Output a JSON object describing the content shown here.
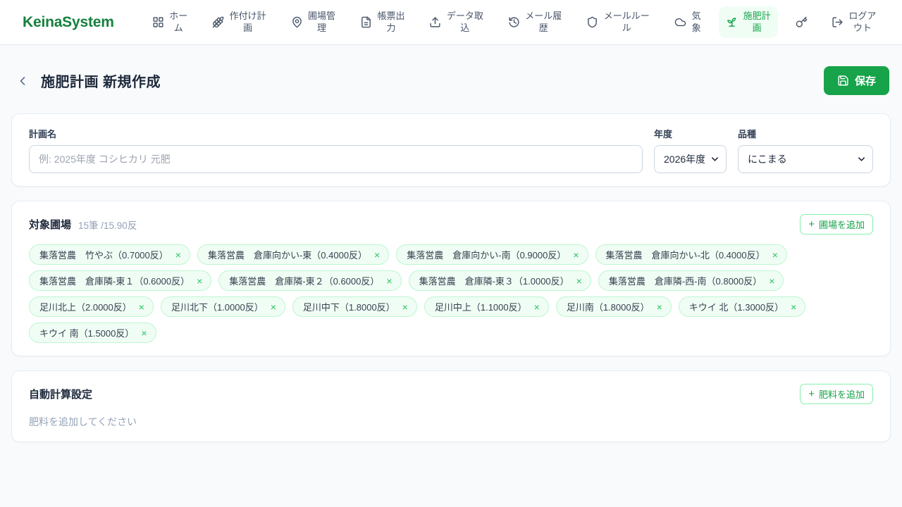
{
  "app": {
    "title": "KeinaSystem"
  },
  "colors": {
    "brand_green": "#15803d",
    "accent_green": "#16a34a",
    "active_nav_bg": "#f0fdf4",
    "chip_bg": "#f0fdf4",
    "chip_border": "#bbf7d0",
    "outline_button_border": "#86efac",
    "page_bg": "#f8fafc"
  },
  "icons": {
    "back": "chevron-left",
    "save": "floppy-disk",
    "select": "chevron-down",
    "nav": [
      "grid",
      "wheat",
      "map-pin",
      "document",
      "upload",
      "history",
      "shield",
      "cloud",
      "sprout",
      "key",
      "logout"
    ]
  },
  "nav": {
    "items": [
      {
        "label": "ホーム",
        "icon": "grid-icon",
        "active": false
      },
      {
        "label": "作付け計画",
        "icon": "wheat-icon",
        "active": false
      },
      {
        "label": "圃場管理",
        "icon": "map-pin-icon",
        "active": false
      },
      {
        "label": "帳票出力",
        "icon": "document-icon",
        "active": false
      },
      {
        "label": "データ取込",
        "icon": "upload-icon",
        "active": false
      },
      {
        "label": "メール履歴",
        "icon": "history-icon",
        "active": false
      },
      {
        "label": "メールルール",
        "icon": "shield-icon",
        "active": false
      },
      {
        "label": "気象",
        "icon": "cloud-icon",
        "active": false
      },
      {
        "label": "施肥計画",
        "icon": "sprout-icon",
        "active": true
      },
      {
        "label": "",
        "icon": "key-icon",
        "active": false
      },
      {
        "label": "ログアウト",
        "icon": "logout-icon",
        "active": false
      }
    ]
  },
  "header": {
    "title": "施肥計画 新規作成",
    "save_button": {
      "label": "保存"
    }
  },
  "plan_form": {
    "plan_name": {
      "label": "計画名",
      "value": "",
      "placeholder": "例: 2025年度 コシヒカリ 元肥"
    },
    "year": {
      "label": "年度",
      "value": "2026年度"
    },
    "variety": {
      "label": "品種",
      "value": "にこまる"
    }
  },
  "fields_section": {
    "title": "対象圃場",
    "summary": "15筆 /15.90反",
    "add_button": {
      "plus": "+",
      "label": "圃場を追加"
    },
    "remove_icon": "×",
    "chips": [
      "集落営農　竹やぶ（0.7000反）",
      "集落営農　倉庫向かい-東（0.4000反）",
      "集落営農　倉庫向かい-南（0.9000反）",
      "集落営農　倉庫向かい-北（0.4000反）",
      "集落営農　倉庫隣-東１（0.6000反）",
      "集落営農　倉庫隣-東２（0.6000反）",
      "集落営農　倉庫隣-東３（1.0000反）",
      "集落営農　倉庫隣-西-南（0.8000反）",
      "足川北上（2.0000反）",
      "足川北下（1.0000反）",
      "足川中下（1.8000反）",
      "足川中上（1.1000反）",
      "足川南（1.8000反）",
      "キウイ 北（1.3000反）",
      "キウイ 南（1.5000反）"
    ]
  },
  "auto_calc_section": {
    "title": "自動計算設定",
    "add_button": {
      "plus": "+",
      "label": "肥料を追加"
    },
    "empty_message": "肥料を追加してください"
  }
}
